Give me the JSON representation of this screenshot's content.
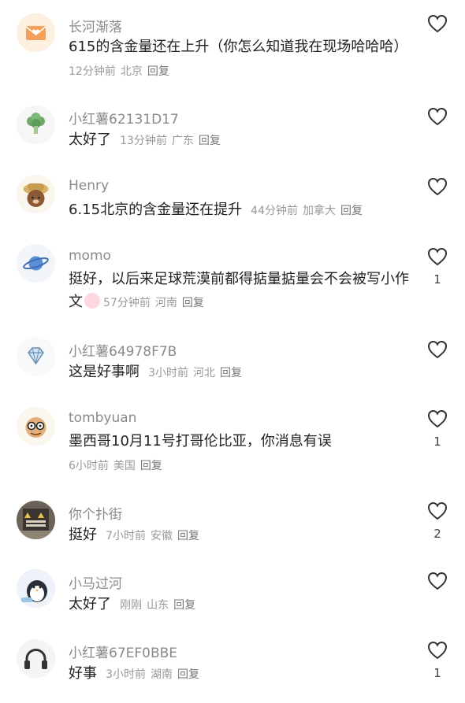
{
  "comments": [
    {
      "username": "长河渐落",
      "text": "615的含金量还在上升（你怎么知道我在现场哈哈哈）",
      "time": "12分钟前",
      "location": "北京",
      "reply": "回复",
      "likes": "",
      "avatar": "envelope-heart-avatar"
    },
    {
      "username": "小红薯62131D17",
      "text": "太好了",
      "time": "13分钟前",
      "location": "广东",
      "reply": "回复",
      "likes": "",
      "avatar": "broccoli-avatar"
    },
    {
      "username": "Henry",
      "text": "6.15北京的含金量还在提升",
      "time": "44分钟前",
      "location": "加拿大",
      "reply": "回复",
      "likes": "",
      "avatar": "bear-hat-avatar"
    },
    {
      "username": "momo",
      "text": "挺好，以后来足球荒漠前都得掂量掂量会不会被写小作文",
      "time": "57分钟前",
      "location": "河南",
      "reply": "回复",
      "likes": "1",
      "avatar": "planet-avatar"
    },
    {
      "username": "小红薯64978F7B",
      "text": "这是好事啊",
      "time": "3小时前",
      "location": "河北",
      "reply": "回复",
      "likes": "",
      "avatar": "diamond-avatar"
    },
    {
      "username": "tombyuan",
      "text": "墨西哥10月11号打哥伦比亚，你消息有误",
      "time": "6小时前",
      "location": "美国",
      "reply": "回复",
      "likes": "1",
      "avatar": "cartoon-glasses-avatar"
    },
    {
      "username": "你个扑街",
      "text": "挺好",
      "time": "7小时前",
      "location": "安徽",
      "reply": "回复",
      "likes": "2",
      "avatar": "sign-photo-avatar"
    },
    {
      "username": "小马过河",
      "text": "太好了",
      "time": "刚刚",
      "location": "山东",
      "reply": "回复",
      "likes": "",
      "avatar": "penguin-avatar"
    },
    {
      "username": "小红薯67EF0BBE",
      "text": "好事",
      "time": "3小时前",
      "location": "湖南",
      "reply": "回复",
      "likes": "1",
      "avatar": "headphones-avatar"
    }
  ],
  "colors": {
    "username": "#8a8a8a",
    "text": "#222222",
    "meta": "#999999",
    "heart": "#333333"
  }
}
